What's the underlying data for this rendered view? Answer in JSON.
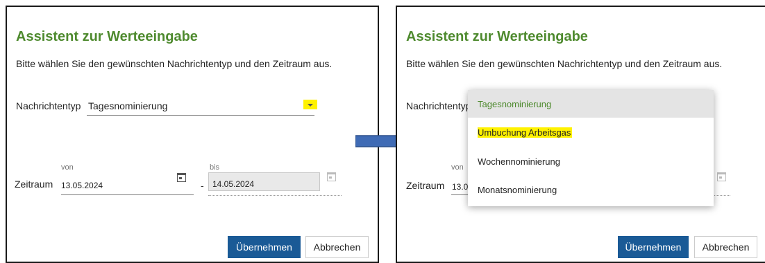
{
  "left_dialog": {
    "title": "Assistent zur Werteeingabe",
    "instruction": "Bitte wählen Sie den gewünschten Nachrichtentyp und den Zeitraum aus.",
    "message_type_label": "Nachrichtentyp",
    "message_type_value": "Tagesnominierung",
    "period_label": "Zeitraum",
    "from_label": "von",
    "from_value": "13.05.2024",
    "separator": "-",
    "to_label": "bis",
    "to_value": "14.05.2024",
    "apply_label": "Übernehmen",
    "cancel_label": "Abbrechen"
  },
  "right_dialog": {
    "title": "Assistent zur Werteeingabe",
    "instruction": "Bitte wählen Sie den gewünschten Nachrichtentyp und den Zeitraum aus.",
    "message_type_label": "Nachrichtentyp",
    "period_label": "Zeitraum",
    "from_label": "von",
    "from_value_partial": "13.0",
    "apply_label": "Übernehmen",
    "cancel_label": "Abbrechen",
    "dropdown_options": [
      "Tagesnominierung",
      "Umbuchung Arbeitsgas",
      "Wochennominierung",
      "Monatsnominierung"
    ]
  },
  "colors": {
    "title_green": "#4e8a2e",
    "primary_button": "#1a5a96",
    "highlight_yellow": "#fff200",
    "arrow_blue": "#3f6bb5"
  }
}
